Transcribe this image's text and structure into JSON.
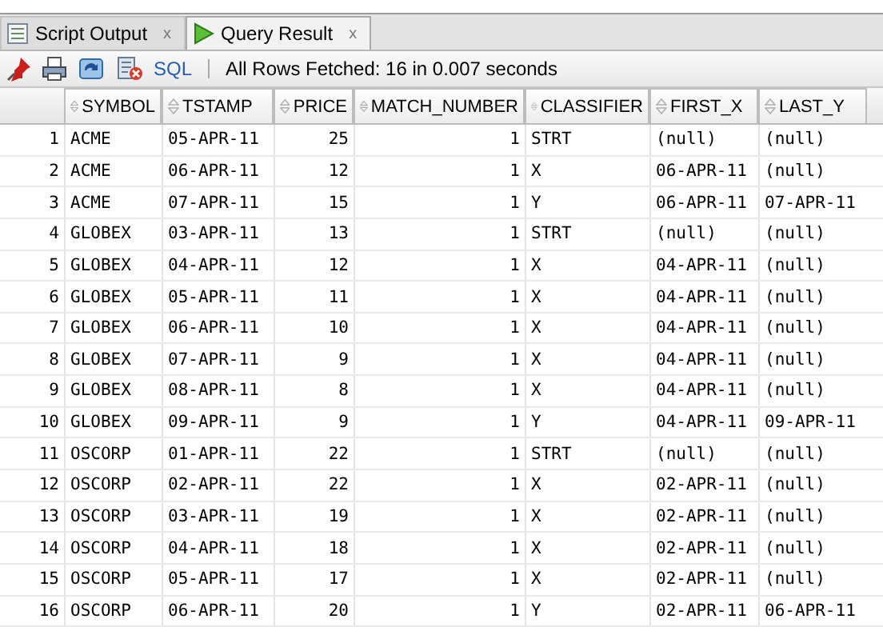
{
  "tabs": [
    {
      "label": "Script Output",
      "close": "x",
      "selected": false
    },
    {
      "label": "Query Result",
      "close": "x",
      "selected": true
    }
  ],
  "toolbar": {
    "sql_link": "SQL",
    "status": "All Rows Fetched: 16 in 0.007 seconds"
  },
  "table": {
    "columns": [
      {
        "label": "SYMBOL",
        "kind": "text"
      },
      {
        "label": "TSTAMP",
        "kind": "text"
      },
      {
        "label": "PRICE",
        "kind": "number"
      },
      {
        "label": "MATCH_NUMBER",
        "kind": "number"
      },
      {
        "label": "CLASSIFIER",
        "kind": "text"
      },
      {
        "label": "FIRST_X",
        "kind": "text"
      },
      {
        "label": "LAST_Y",
        "kind": "text"
      }
    ],
    "rows": [
      {
        "number": "1",
        "cells": [
          "ACME",
          "05-APR-11",
          "25",
          "1",
          "STRT",
          "(null)",
          "(null)"
        ]
      },
      {
        "number": "2",
        "cells": [
          "ACME",
          "06-APR-11",
          "12",
          "1",
          "X",
          "06-APR-11",
          "(null)"
        ]
      },
      {
        "number": "3",
        "cells": [
          "ACME",
          "07-APR-11",
          "15",
          "1",
          "Y",
          "06-APR-11",
          "07-APR-11"
        ]
      },
      {
        "number": "4",
        "cells": [
          "GLOBEX",
          "03-APR-11",
          "13",
          "1",
          "STRT",
          "(null)",
          "(null)"
        ]
      },
      {
        "number": "5",
        "cells": [
          "GLOBEX",
          "04-APR-11",
          "12",
          "1",
          "X",
          "04-APR-11",
          "(null)"
        ]
      },
      {
        "number": "6",
        "cells": [
          "GLOBEX",
          "05-APR-11",
          "11",
          "1",
          "X",
          "04-APR-11",
          "(null)"
        ]
      },
      {
        "number": "7",
        "cells": [
          "GLOBEX",
          "06-APR-11",
          "10",
          "1",
          "X",
          "04-APR-11",
          "(null)"
        ]
      },
      {
        "number": "8",
        "cells": [
          "GLOBEX",
          "07-APR-11",
          "9",
          "1",
          "X",
          "04-APR-11",
          "(null)"
        ]
      },
      {
        "number": "9",
        "cells": [
          "GLOBEX",
          "08-APR-11",
          "8",
          "1",
          "X",
          "04-APR-11",
          "(null)"
        ]
      },
      {
        "number": "10",
        "cells": [
          "GLOBEX",
          "09-APR-11",
          "9",
          "1",
          "Y",
          "04-APR-11",
          "09-APR-11"
        ]
      },
      {
        "number": "11",
        "cells": [
          "OSCORP",
          "01-APR-11",
          "22",
          "1",
          "STRT",
          "(null)",
          "(null)"
        ]
      },
      {
        "number": "12",
        "cells": [
          "OSCORP",
          "02-APR-11",
          "22",
          "1",
          "X",
          "02-APR-11",
          "(null)"
        ]
      },
      {
        "number": "13",
        "cells": [
          "OSCORP",
          "03-APR-11",
          "19",
          "1",
          "X",
          "02-APR-11",
          "(null)"
        ]
      },
      {
        "number": "14",
        "cells": [
          "OSCORP",
          "04-APR-11",
          "18",
          "1",
          "X",
          "02-APR-11",
          "(null)"
        ]
      },
      {
        "number": "15",
        "cells": [
          "OSCORP",
          "05-APR-11",
          "17",
          "1",
          "X",
          "02-APR-11",
          "(null)"
        ]
      },
      {
        "number": "16",
        "cells": [
          "OSCORP",
          "06-APR-11",
          "20",
          "1",
          "Y",
          "02-APR-11",
          "06-APR-11"
        ]
      }
    ]
  }
}
